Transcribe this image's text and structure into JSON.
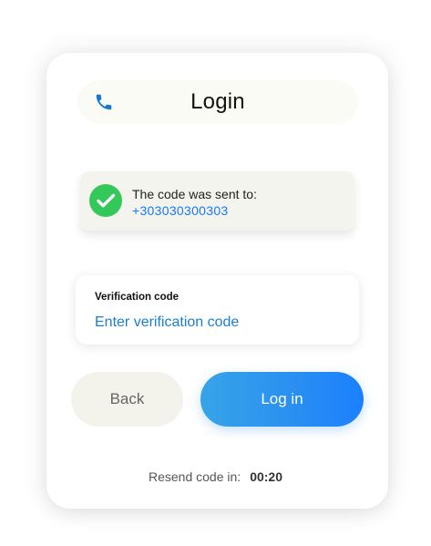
{
  "header": {
    "title": "Login",
    "icon": "phone-icon",
    "icon_color": "#1677cc"
  },
  "notice": {
    "icon": "check-circle-icon",
    "icon_color": "#34c759",
    "line1": "The code was sent to:",
    "phone": "+303030300303"
  },
  "verification": {
    "label": "Verification code",
    "placeholder": "Enter verification code",
    "value": ""
  },
  "buttons": {
    "back_label": "Back",
    "login_label": "Log in"
  },
  "resend": {
    "label": "Resend code in:",
    "timer": "00:20"
  },
  "colors": {
    "accent": "#1a80ff",
    "card_bg": "#ffffff",
    "muted_bg": "#f3f3ec"
  }
}
